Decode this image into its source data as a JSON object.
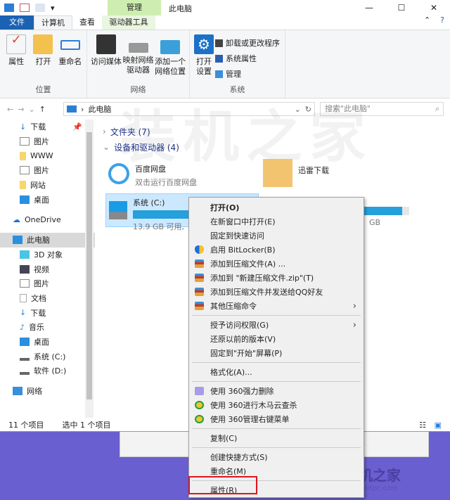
{
  "window": {
    "title": "此电脑",
    "context_tab": "管理"
  },
  "tabs": [
    "文件",
    "计算机",
    "查看",
    "驱动器工具"
  ],
  "ribbon": {
    "groups": [
      {
        "label": "位置",
        "buttons": [
          "属性",
          "打开",
          "重命名"
        ]
      },
      {
        "label": "网络",
        "buttons": [
          "访问媒体",
          "映射网络驱动器",
          "添加一个网络位置"
        ]
      },
      {
        "label": "系统",
        "buttons": [
          "打开设置"
        ],
        "small": [
          "卸载或更改程序",
          "系统属性",
          "管理"
        ]
      }
    ]
  },
  "address": {
    "path": "此电脑",
    "search_placeholder": "搜索\"此电脑\""
  },
  "nav": {
    "items": [
      "下载",
      "图片",
      "WWW",
      "图片",
      "网站",
      "桌面",
      "OneDrive",
      "此电脑",
      "3D 对象",
      "视频",
      "图片",
      "文档",
      "下载",
      "音乐",
      "桌面",
      "系统 (C:)",
      "软件 (D:)",
      "网络"
    ]
  },
  "content": {
    "folders_header": "文件夹 (7)",
    "devices_header": "设备和驱动器 (4)",
    "baidu": {
      "name": "百度网盘",
      "desc": "双击运行百度网盘"
    },
    "xunlei": {
      "name": "迅雷下载"
    },
    "c_drive": {
      "name": "系统 (C:)",
      "free": "13.9 GB 可用,",
      "used_fraction": 0.75
    },
    "d_drive": {
      "size_tail": "GB",
      "used_fraction": 0.85
    }
  },
  "status": {
    "count": "11 个项目",
    "selected": "选中 1 个项目"
  },
  "context_menu": [
    {
      "label": "打开(O)",
      "bold": true
    },
    {
      "label": "在新窗口中打开(E)"
    },
    {
      "label": "固定到快速访问"
    },
    {
      "label": "启用 BitLocker(B)",
      "icon": "shield"
    },
    {
      "label": "添加到压缩文件(A) ...",
      "icon": "archive"
    },
    {
      "label": "添加到 \"新建压缩文件.zip\"(T)",
      "icon": "archive"
    },
    {
      "label": "添加到压缩文件并发送给QQ好友",
      "icon": "archive"
    },
    {
      "label": "其他压缩命令",
      "icon": "archive",
      "submenu": true
    },
    {
      "sep": true
    },
    {
      "label": "授予访问权限(G)",
      "submenu": true
    },
    {
      "label": "还原以前的版本(V)"
    },
    {
      "label": "固定到\"开始\"屏幕(P)"
    },
    {
      "sep": true
    },
    {
      "label": "格式化(A)..."
    },
    {
      "sep": true
    },
    {
      "label": "使用 360强力删除",
      "icon": "360-delete"
    },
    {
      "label": "使用 360进行木马云查杀",
      "icon": "360"
    },
    {
      "label": "使用 360管理右键菜单",
      "icon": "360"
    },
    {
      "sep": true
    },
    {
      "label": "复制(C)"
    },
    {
      "sep": true
    },
    {
      "label": "创建快捷方式(S)"
    },
    {
      "label": "重命名(M)"
    },
    {
      "sep": true
    },
    {
      "label": "属性(R)"
    }
  ],
  "watermark": {
    "text": "装机之家",
    "url": "www.lotpc.com"
  },
  "colors": {
    "file_tab": "#1b62b3",
    "accent": "#26a0da",
    "highlight": "#e0141e",
    "background": "#6a5fd0"
  }
}
